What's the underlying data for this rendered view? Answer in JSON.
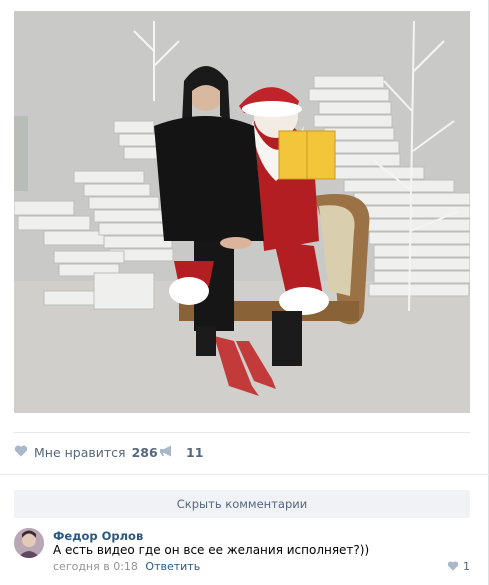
{
  "post": {
    "image_alt": "photo-santa-books"
  },
  "actions": {
    "like_label": "Мне нравится",
    "like_count": "286",
    "share_count": "11"
  },
  "comments": {
    "hide_label": "Скрыть комментарии",
    "items": [
      {
        "author": "Федор Орлов",
        "text": "А есть видео где он все ее желания исполняет?))",
        "time": "сегодня в 0:18",
        "reply_label": "Ответить",
        "likes": "1"
      }
    ]
  },
  "colors": {
    "link": "#2a5885",
    "muted": "#55677d",
    "icon": "#aab8c9"
  }
}
